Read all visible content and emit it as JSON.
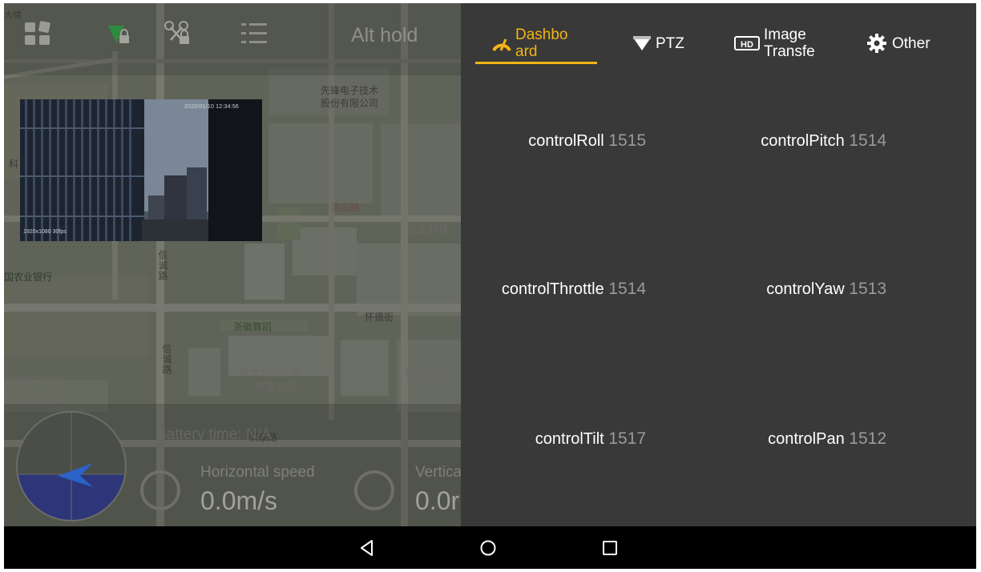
{
  "toolbar": {
    "mode_label": "Alt hold",
    "icons": [
      "apps-grid-icon",
      "signal-lock-icon",
      "drone-lock-icon",
      "list-menu-icon"
    ]
  },
  "map": {
    "labels": {
      "company1_a": "先锋电子技术",
      "company1_b": "股份有限公司",
      "road_binan": "滨安路",
      "youmai": "优迈科技",
      "bank": "国农业银行",
      "road_xincheng1": "信诚路",
      "road_xincheng2": "信诚路",
      "zhehuibuilding": "浙徽舞蹈",
      "road_huaide": "怀德街",
      "datang_a": "浙大迪迅生物",
      "datang_b": "有限公司",
      "hangzhou_kaihe_a": "杭州凯和精工",
      "hangzhou_kaihe_b": "机械有限公司",
      "hangzhou_jinggong": "杭州精工",
      "road_bin": "滨康路",
      "corner_top": "大楼",
      "corner_left": "科"
    }
  },
  "camera": {
    "osd_top": "2020/01/10 12:34:56",
    "osd_bottom": "1920x1080 30fps"
  },
  "telemetry": {
    "battery_label": "Battery time: ",
    "battery_value": "N/A",
    "horizontal_speed_label": "Horizontal speed",
    "horizontal_speed_value": "0.0m/s",
    "vertical_speed_label": "Vertica",
    "vertical_speed_value": "0.0r"
  },
  "panel": {
    "tabs": [
      {
        "line1": "Dashbo",
        "line2": "ard",
        "icon": "gauge-icon",
        "active": true
      },
      {
        "line1": "PTZ",
        "line2": "",
        "icon": "gimbal-icon",
        "active": false
      },
      {
        "line1": "Image",
        "line2": "Transfe",
        "icon": "hd-icon",
        "active": false
      },
      {
        "line1": "Other",
        "line2": "",
        "icon": "gear-icon",
        "active": false
      }
    ],
    "controls": [
      {
        "name": "controlRoll",
        "value": "1515"
      },
      {
        "name": "controlPitch",
        "value": "1514"
      },
      {
        "name": "controlThrottle",
        "value": "1514"
      },
      {
        "name": "controlYaw",
        "value": "1513"
      },
      {
        "name": "controlTilt",
        "value": "1517"
      },
      {
        "name": "controlPan",
        "value": "1512"
      }
    ]
  },
  "colors": {
    "accent": "#f3b417",
    "panel_bg": "#393939",
    "value_gray": "#9a9a9a"
  },
  "navbar": {
    "icons": [
      "back-triangle-icon",
      "home-circle-icon",
      "recents-square-icon"
    ]
  }
}
